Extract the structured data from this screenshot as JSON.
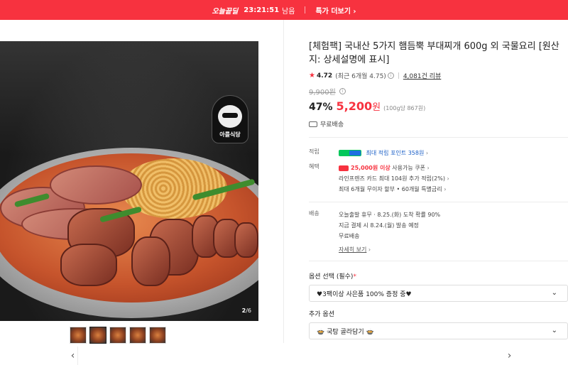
{
  "topbar": {
    "brand": "오늘끝딜",
    "timer": "23:21:51",
    "timer_suffix": "남음",
    "more": "특가 더보기 ›"
  },
  "gallery": {
    "logo_name": "아를식당",
    "current": "2",
    "total": "/6",
    "prev_icon": "chevron-left-icon",
    "next_icon": "chevron-right-icon",
    "prev": "‹",
    "next": "›"
  },
  "product": {
    "title": "[체험팩] 국내산 5가지 햄듬뿍 부대찌개 600g 외 국물요리 [원산지: 상세설명에 표시]",
    "rating": "4.72",
    "rating_recent": "(최근 6개월 4.75)",
    "reviews": "4,081건 리뷰",
    "original_price": "9,900원",
    "discount": "47%",
    "price": "5,200",
    "won": "원",
    "unit_price": "(100g당 867원)",
    "shipping": "무료배송"
  },
  "benefits": {
    "points_label": "적립",
    "points_text": "최대 적립 포인트 358원",
    "benefit_label": "혜택",
    "coupon_amount": "25,000원 이상",
    "coupon_text": " 사용가능 쿠폰",
    "card_text": "라인프렌즈 카드 최대 104원 추가 적립(2%)",
    "installment_text": "최대 6개월 무이자 할부 • 60개월 특별금리"
  },
  "delivery": {
    "label": "배송",
    "line1": "오늘출발 휴무 · 8.25.(화) 도착 확률 90%",
    "line2": "지금 결제 시 8.24.(월) 발송 예정",
    "line3": "무료배송",
    "detail": "자세히 보기"
  },
  "options": {
    "select_label": "옵션 선택 (필수)",
    "required_mark": "*",
    "select_value": "♥3팩이상 사은품 100% 증정 중♥",
    "extra_label": "추가 옵션",
    "extra_value": "🍲 국탕 골라담기 🍲",
    "caret": "⌄"
  }
}
